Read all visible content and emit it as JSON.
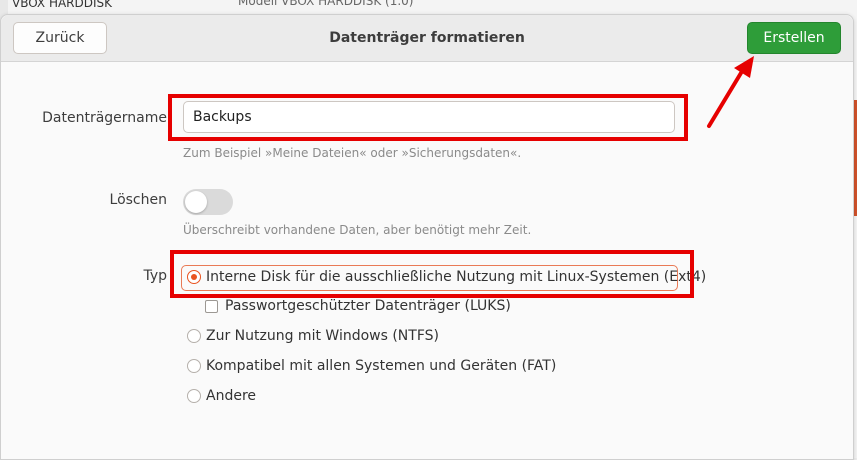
{
  "background": {
    "top_left_label": "VBOX HARDDISK",
    "top_center_text": "Modell    VBOX HARDDISK (1.0)"
  },
  "dialog": {
    "title": "Datenträger formatieren",
    "back_label": "Zurück",
    "create_label": "Erstellen"
  },
  "form": {
    "name_label": "Datenträgername",
    "name_value": "Backups",
    "name_hint": "Zum Beispiel »Meine Dateien« oder »Sicherungsdaten«.",
    "erase_label": "Löschen",
    "erase_on": false,
    "erase_hint": "Überschreibt vorhandene Daten, aber benötigt mehr Zeit.",
    "type_label": "Typ",
    "type_options": [
      {
        "label": "Interne Disk für die ausschließliche Nutzung mit Linux-Systemen (Ext4)",
        "checked": true
      },
      {
        "label": "Zur Nutzung mit Windows (NTFS)",
        "checked": false
      },
      {
        "label": "Kompatibel mit allen Systemen und Geräten (FAT)",
        "checked": false
      },
      {
        "label": "Andere",
        "checked": false
      }
    ],
    "luks_label": "Passwortgeschützter Datenträger (LUKS)",
    "luks_checked": false
  },
  "colors": {
    "accent": "#e95420",
    "create_button": "#2e9d39",
    "annotation": "#e60000"
  },
  "icons": [
    "radio-checked-icon",
    "radio-unchecked-icon",
    "checkbox-icon",
    "annotation-arrow-icon"
  ]
}
